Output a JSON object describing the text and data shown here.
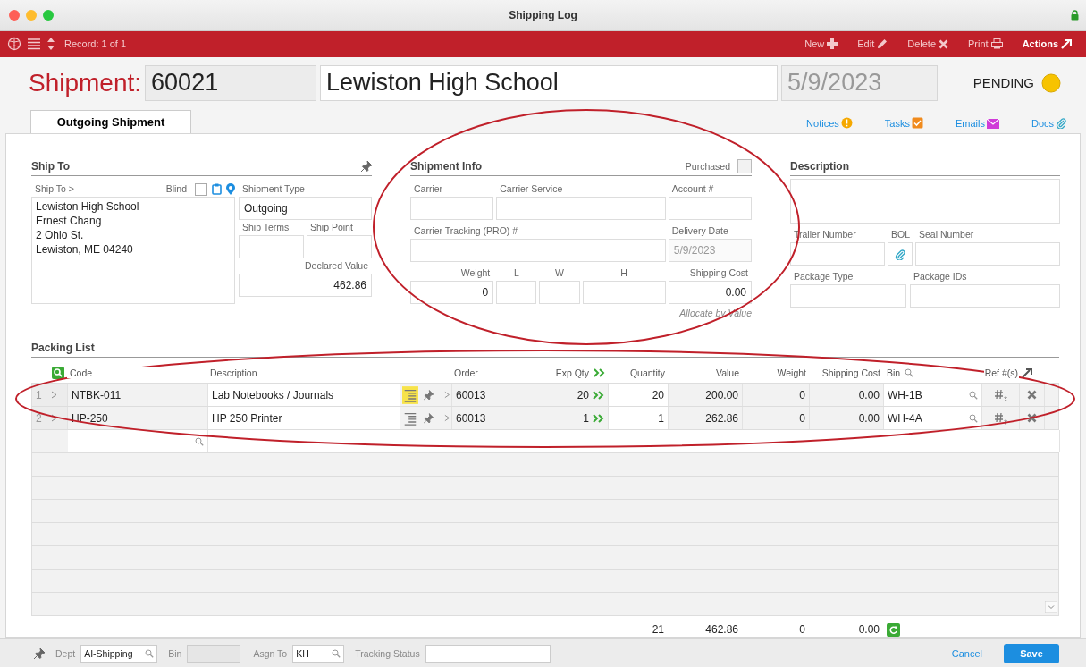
{
  "window": {
    "title": "Shipping Log"
  },
  "toolbar": {
    "record": "Record: 1 of 1",
    "actions": [
      {
        "label": "New",
        "kind": "new",
        "emphasized": false
      },
      {
        "label": "Edit",
        "kind": "edit",
        "emphasized": false
      },
      {
        "label": "Delete",
        "kind": "delete",
        "emphasized": false
      },
      {
        "label": "Print",
        "kind": "print",
        "emphasized": false
      },
      {
        "label": "Actions",
        "kind": "actions",
        "emphasized": true
      }
    ]
  },
  "header": {
    "label": "Shipment:",
    "number": "60021",
    "name": "Lewiston High School",
    "date": "5/9/2023",
    "status": "PENDING"
  },
  "tabs": [
    {
      "label": "Outgoing Shipment",
      "selected": true
    }
  ],
  "links": [
    {
      "label": "Notices",
      "kind": "notices"
    },
    {
      "label": "Tasks",
      "kind": "tasks"
    },
    {
      "label": "Emails",
      "kind": "emails"
    },
    {
      "label": "Docs",
      "kind": "docs"
    }
  ],
  "ship_to": {
    "title": "Ship To",
    "ship_to_label": "Ship To >",
    "blind_label": "Blind",
    "blind_checked": false,
    "address": [
      "Lewiston High School",
      "Ernest Chang",
      "2 Ohio St.",
      "Lewiston, ME 04240"
    ],
    "shipment_type_label": "Shipment Type",
    "shipment_type": "Outgoing",
    "ship_terms_label": "Ship Terms",
    "ship_point_label": "Ship Point",
    "declared_value_label": "Declared Value",
    "declared_value": "462.86"
  },
  "shipment_info": {
    "title": "Shipment Info",
    "purchased_label": "Purchased",
    "purchased": false,
    "carrier_label": "Carrier",
    "carrier_service_label": "Carrier Service",
    "account_label": "Account #",
    "tracking_label": "Carrier Tracking (PRO) #",
    "delivery_date_label": "Delivery Date",
    "delivery_date": "5/9/2023",
    "weight_label": "Weight",
    "weight": "0",
    "l_label": "L",
    "w_label": "W",
    "h_label": "H",
    "shipping_cost_label": "Shipping Cost",
    "shipping_cost": "0.00",
    "allocate_note": "Allocate by Value"
  },
  "description": {
    "title": "Description",
    "trailer_number_label": "Trailer Number",
    "bol_label": "BOL",
    "seal_number_label": "Seal Number",
    "package_type_label": "Package Type",
    "package_ids_label": "Package IDs"
  },
  "packing_list": {
    "title": "Packing List",
    "columns": [
      "Code",
      "Description",
      "Order",
      "Exp Qty",
      "Quantity",
      "Value",
      "Weight",
      "Shipping Cost",
      "Bin",
      "Ref #(s)"
    ],
    "rows": [
      {
        "line": "1",
        "code": "NTBK-011",
        "description": "Lab Notebooks / Journals",
        "notes_highlighted": true,
        "order": "60013",
        "exp_qty": "20",
        "quantity": "20",
        "value": "200.00",
        "weight": "0",
        "shipping_cost": "0.00",
        "bin": "WH-1B"
      },
      {
        "line": "2",
        "code": "HP-250",
        "description": "HP 250 Printer",
        "notes_highlighted": false,
        "order": "60013",
        "exp_qty": "1",
        "quantity": "1",
        "value": "262.86",
        "weight": "0",
        "shipping_cost": "0.00",
        "bin": "WH-4A"
      }
    ],
    "totals": {
      "quantity": "21",
      "value": "462.86",
      "weight": "0",
      "shipping_cost": "0.00"
    }
  },
  "footer": {
    "dept_label": "Dept",
    "dept": "AI-Shipping",
    "bin_label": "Bin",
    "asgn_label": "Asgn To",
    "asgn": "KH",
    "tracking_label": "Tracking Status",
    "cancel": "Cancel",
    "save": "Save"
  }
}
